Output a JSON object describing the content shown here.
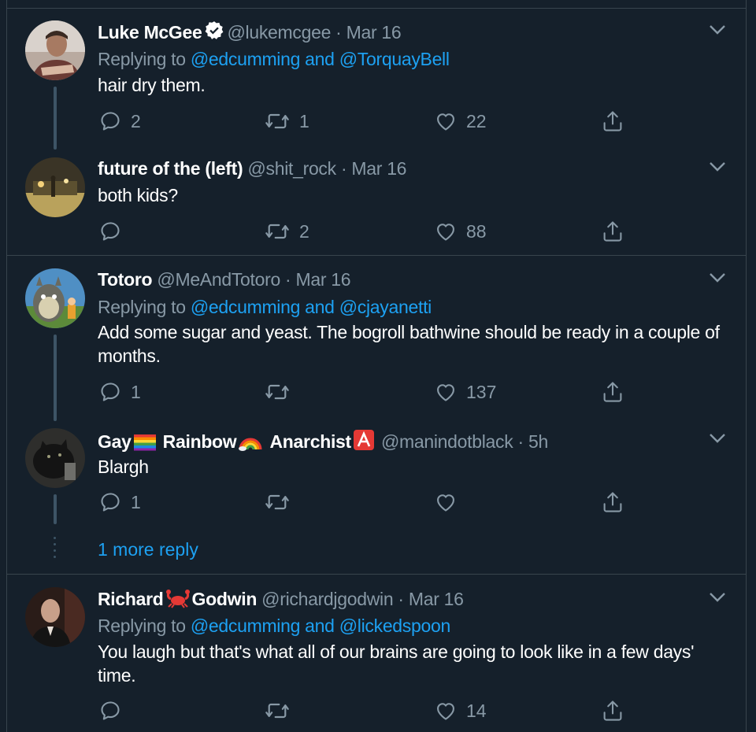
{
  "tweets": [
    {
      "name": "Luke McGee",
      "verified": true,
      "handle": "@lukemcgee",
      "time": "Mar 16",
      "replying_prefix": "Replying to ",
      "replying_to": "@edcumming and @TorquayBell",
      "text": "hair dry them.",
      "replies": "2",
      "retweets": "1",
      "likes": "22"
    },
    {
      "name": "future of the (left)",
      "handle": "@shit_rock",
      "time": "Mar 16",
      "text": "both kids?",
      "replies": "",
      "retweets": "2",
      "likes": "88"
    },
    {
      "name": "Totoro",
      "handle": "@MeAndTotoro",
      "time": "Mar 16",
      "replying_prefix": "Replying to ",
      "replying_to": "@edcumming and @cjayanetti",
      "text": "Add some sugar and yeast. The bogroll bathwine should be ready in a couple of months.",
      "replies": "1",
      "retweets": "",
      "likes": "137"
    },
    {
      "name_parts": [
        "Gay",
        "Rainbow",
        "Anarchist"
      ],
      "handle": "@manindotblack",
      "time": "5h",
      "text": "Blargh",
      "replies": "1",
      "retweets": "",
      "likes": ""
    },
    {
      "name_parts": [
        "Richard",
        "Godwin"
      ],
      "handle": "@richardjgodwin",
      "time": "Mar 16",
      "replying_prefix": "Replying to ",
      "replying_to": "@edcumming and @lickedspoon",
      "text": "You laugh but that's what all of our brains are going to look like in a few days' time.",
      "replies": "",
      "retweets": "",
      "likes": "14"
    }
  ],
  "more_replies": "1 more reply",
  "separator_dot": "·",
  "colors": {
    "background": "#15202b",
    "secondary_text": "#8899a6",
    "link": "#1da1f2",
    "border": "#38444d"
  },
  "icons": [
    "verified-badge-icon",
    "chevron-down-icon",
    "reply-icon",
    "retweet-icon",
    "like-icon",
    "share-icon",
    "rainbow-flag-emoji",
    "rainbow-emoji",
    "anarchy-a-emoji",
    "crab-emoji"
  ]
}
